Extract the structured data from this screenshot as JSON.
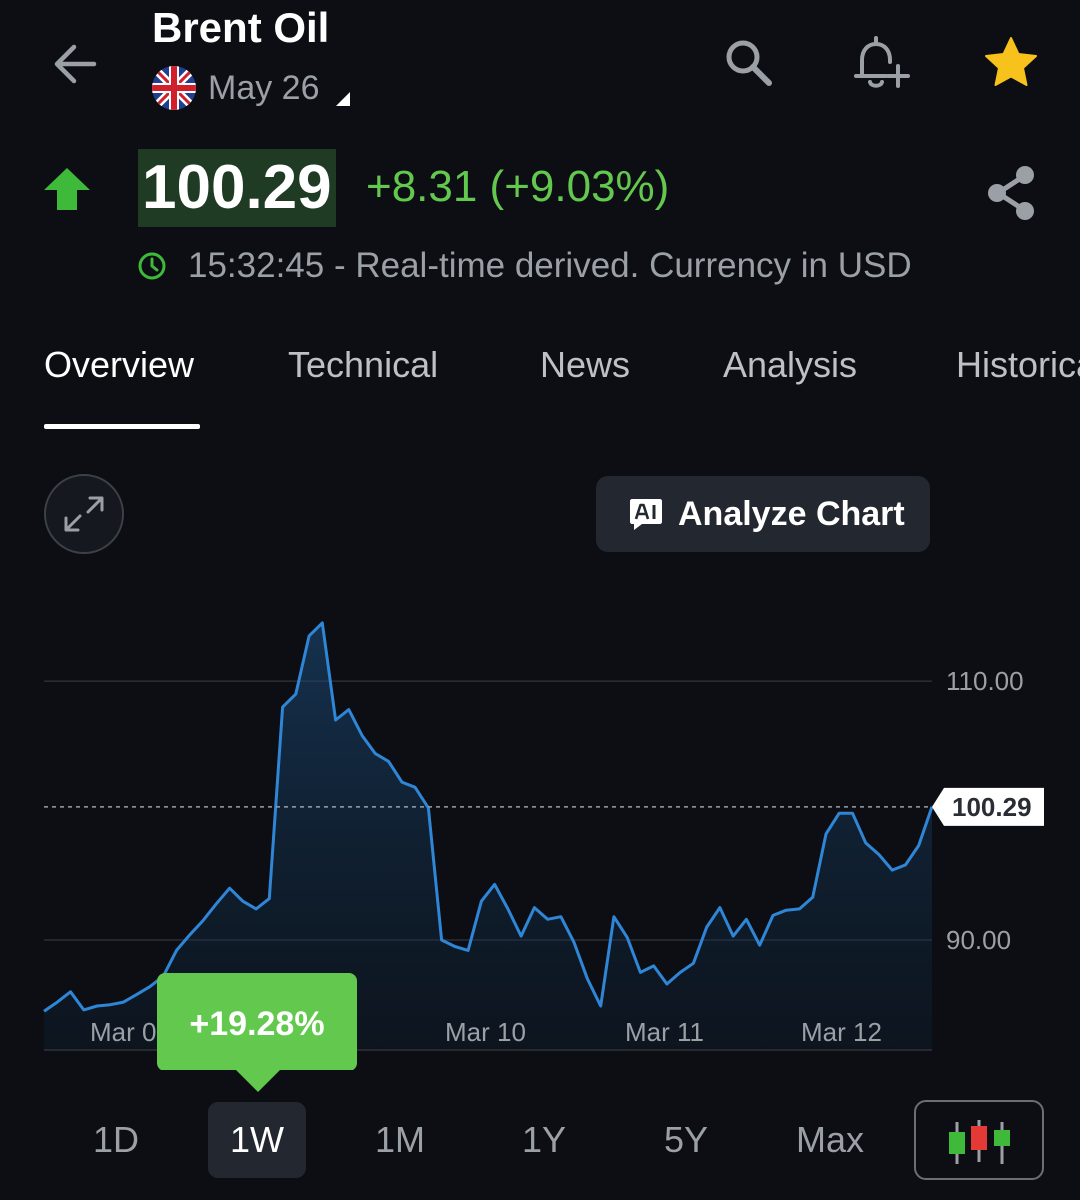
{
  "header": {
    "title": "Brent Oil",
    "contract": "May 26"
  },
  "quote": {
    "price": "100.29",
    "change": "+8.31 (+9.03%)",
    "status": "15:32:45 - Real-time derived. Currency in USD"
  },
  "tabs": [
    {
      "label": "Overview",
      "active": true
    },
    {
      "label": "Technical"
    },
    {
      "label": "News"
    },
    {
      "label": "Analysis"
    },
    {
      "label": "Historical"
    }
  ],
  "analyze_label": "Analyze Chart",
  "colors": {
    "background": "#0c0e13",
    "up": "#63c94e",
    "line": "#2f86d6",
    "star": "#f6c21b",
    "candle_green": "#3fb93a",
    "candle_red": "#e53935"
  },
  "chart_data": {
    "type": "area",
    "y_ticks": [
      "110.00",
      "90.00"
    ],
    "ylim": [
      81.5,
      115.5
    ],
    "x_ticks": [
      "Mar 09",
      "Mar 10",
      "Mar 11",
      "Mar 12"
    ],
    "last_price_label": "100.29",
    "last_value": 100.29,
    "period_change_label": "+19.28%",
    "values": [
      84.5,
      85.2,
      86.0,
      84.6,
      84.9,
      85.0,
      85.2,
      85.8,
      86.4,
      87.2,
      89.2,
      90.4,
      91.5,
      92.8,
      94.0,
      93.0,
      92.4,
      93.2,
      108.0,
      109.0,
      113.5,
      114.5,
      107.0,
      107.8,
      105.8,
      104.4,
      103.8,
      102.2,
      101.8,
      100.2,
      90.0,
      89.5,
      89.2,
      93.0,
      94.3,
      92.4,
      90.3,
      92.5,
      91.6,
      91.8,
      89.8,
      87.0,
      84.9,
      91.8,
      90.2,
      87.5,
      88.0,
      86.6,
      87.5,
      88.2,
      91.0,
      92.5,
      90.3,
      91.6,
      89.6,
      91.9,
      92.3,
      92.4,
      93.3,
      98.2,
      99.8,
      99.8,
      97.5,
      96.6,
      95.4,
      95.8,
      97.3,
      100.29
    ],
    "grid": true
  },
  "ranges": [
    {
      "label": "1D"
    },
    {
      "label": "1W",
      "active": true
    },
    {
      "label": "1M"
    },
    {
      "label": "1Y"
    },
    {
      "label": "5Y"
    },
    {
      "label": "Max"
    }
  ]
}
